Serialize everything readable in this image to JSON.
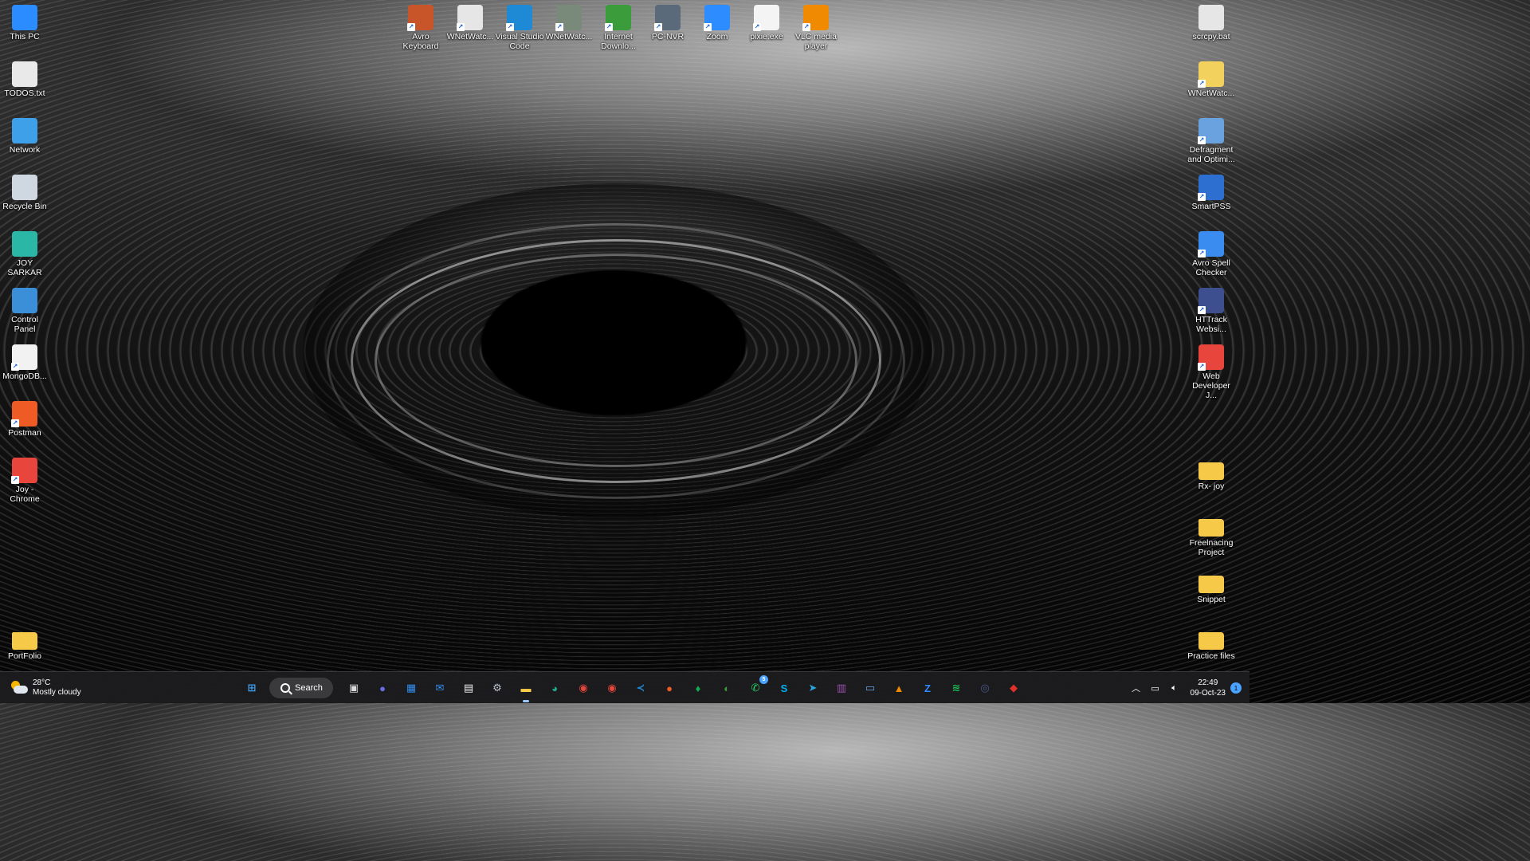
{
  "desktop": {
    "left_column": [
      {
        "name": "this-pc",
        "label": "This PC",
        "icon": "monitor-icon",
        "color": "#2a8cff"
      },
      {
        "name": "todos-txt",
        "label": "TODOS.txt",
        "icon": "text-file-icon",
        "color": "#e9e9e9"
      },
      {
        "name": "network",
        "label": "Network",
        "icon": "network-icon",
        "color": "#3da0e8"
      },
      {
        "name": "recycle-bin",
        "label": "Recycle Bin",
        "icon": "recycle-bin-icon",
        "color": "#cfd8e0"
      },
      {
        "name": "joy-sarkar",
        "label": "JOY SARKAR",
        "icon": "user-folder-icon",
        "color": "#2bb7a6"
      },
      {
        "name": "control-panel",
        "label": "Control Panel",
        "icon": "control-panel-icon",
        "color": "#3a8fd8"
      },
      {
        "name": "mongodb",
        "label": "MongoDB...",
        "icon": "mongodb-icon",
        "color": "#f2f2f2"
      },
      {
        "name": "postman",
        "label": "Postman",
        "icon": "postman-icon",
        "color": "#ef5b25"
      },
      {
        "name": "joy-chrome",
        "label": "Joy - Chrome",
        "icon": "chrome-icon",
        "color": "#e8453c"
      },
      {
        "name": "portfolio",
        "label": "PortFolio",
        "icon": "folder-icon",
        "color": "#f7c948"
      }
    ],
    "top_row": [
      {
        "name": "avro-keyboard",
        "label": "Avro Keyboard",
        "icon": "avro-keyboard-icon",
        "color": "#c8552a"
      },
      {
        "name": "wnetwatcher-1",
        "label": "WNetWatc...",
        "icon": "gear-icon",
        "color": "#e6e6e6"
      },
      {
        "name": "visual-studio-code",
        "label": "Visual Studio Code",
        "icon": "vscode-icon",
        "color": "#1e8ad6"
      },
      {
        "name": "wnetwatcher-2",
        "label": "WNetWatc...",
        "icon": "eye-icon",
        "color": "#7a8a7a"
      },
      {
        "name": "internet-download-manager",
        "label": "Internet Downlo...",
        "icon": "idm-icon",
        "color": "#3b9c3b"
      },
      {
        "name": "pc-nvr",
        "label": "PC-NVR",
        "icon": "pc-nvr-icon",
        "color": "#5a6a7a"
      },
      {
        "name": "zoom",
        "label": "Zoom",
        "icon": "zoom-icon",
        "color": "#2d8cff"
      },
      {
        "name": "pixie-exe",
        "label": "pixie.exe",
        "icon": "color-picker-icon",
        "color": "#f4f4f4"
      },
      {
        "name": "vlc-media-player",
        "label": "VLC media player",
        "icon": "vlc-icon",
        "color": "#f08a00"
      }
    ],
    "right_column": [
      {
        "name": "scrcpy-bat",
        "label": "scrcpy.bat",
        "icon": "gear-file-icon",
        "color": "#e6e6e6"
      },
      {
        "name": "wnetwatcher-3",
        "label": "WNetWatc...",
        "icon": "help-file-icon",
        "color": "#f2d15c"
      },
      {
        "name": "defragment",
        "label": "Defragment and Optimi...",
        "icon": "defrag-icon",
        "color": "#6aa2e0"
      },
      {
        "name": "smartpss",
        "label": "SmartPSS",
        "icon": "camera-icon",
        "color": "#2c6fd1"
      },
      {
        "name": "avro-spell-checker",
        "label": "Avro Spell Checker",
        "icon": "spell-check-icon",
        "color": "#3a8cf0"
      },
      {
        "name": "httrack",
        "label": "HTTrack Websi...",
        "icon": "httrack-icon",
        "color": "#3d4f8f"
      },
      {
        "name": "web-developer-chrome",
        "label": "Web Developer J...",
        "icon": "chrome-icon",
        "color": "#e8453c"
      },
      {
        "name": "rx-joy",
        "label": "Rx- joy",
        "icon": "folder-icon",
        "color": "#f7c948"
      },
      {
        "name": "freelnacing-project",
        "label": "Freelnacing Project",
        "icon": "folder-icon",
        "color": "#f7c948"
      },
      {
        "name": "snippet",
        "label": "Snippet",
        "icon": "folder-icon",
        "color": "#f7c948"
      },
      {
        "name": "practice-files",
        "label": "Practice files",
        "icon": "folder-icon",
        "color": "#f7c948"
      }
    ]
  },
  "taskbar": {
    "weather": {
      "temp": "28°C",
      "condition": "Mostly cloudy"
    },
    "search_label": "Search",
    "apps": [
      {
        "name": "start",
        "icon": "windows-icon",
        "color": "#3fa3f5",
        "glyph": "⊞"
      },
      {
        "name": "search",
        "icon": "search-icon"
      },
      {
        "name": "task-view",
        "icon": "task-view-icon",
        "color": "#d8d8d8",
        "glyph": "▣"
      },
      {
        "name": "teams-chat",
        "icon": "chat-icon",
        "color": "#6b6be8",
        "glyph": "●"
      },
      {
        "name": "widgets",
        "icon": "widgets-icon",
        "color": "#2f8ef0",
        "glyph": "▦"
      },
      {
        "name": "mail",
        "icon": "mail-icon",
        "color": "#2f8ef0",
        "glyph": "✉"
      },
      {
        "name": "store",
        "icon": "store-icon",
        "color": "#f2f2f2",
        "glyph": "▤"
      },
      {
        "name": "settings",
        "icon": "gear-icon",
        "color": "#b8c4d0",
        "glyph": "⚙"
      },
      {
        "name": "file-explorer",
        "icon": "folder-icon",
        "color": "#f7c948",
        "glyph": "▬",
        "active": true
      },
      {
        "name": "edge",
        "icon": "edge-icon",
        "color": "#1faa8a",
        "glyph": "◕"
      },
      {
        "name": "chrome-1",
        "icon": "chrome-icon",
        "color": "#e8453c",
        "glyph": "◉"
      },
      {
        "name": "chrome-2",
        "icon": "chrome-icon",
        "color": "#e8453c",
        "glyph": "◉"
      },
      {
        "name": "vscode",
        "icon": "vscode-icon",
        "color": "#1e8ad6",
        "glyph": "≺"
      },
      {
        "name": "postman",
        "icon": "postman-icon",
        "color": "#ef5b25",
        "glyph": "●"
      },
      {
        "name": "mongodb",
        "icon": "mongodb-icon",
        "color": "#13aa52",
        "glyph": "♦"
      },
      {
        "name": "idm",
        "icon": "idm-icon",
        "color": "#3b9c3b",
        "glyph": "◐"
      },
      {
        "name": "whatsapp",
        "icon": "whatsapp-icon",
        "color": "#25d366",
        "glyph": "✆",
        "badge": "5"
      },
      {
        "name": "skype",
        "icon": "skype-icon",
        "color": "#00aff0",
        "glyph": "S"
      },
      {
        "name": "telegram",
        "icon": "telegram-icon",
        "color": "#2aa3df",
        "glyph": "➤"
      },
      {
        "name": "winrar",
        "icon": "archive-icon",
        "color": "#9b4fb0",
        "glyph": "▥"
      },
      {
        "name": "remote-desktop",
        "icon": "remote-desktop-icon",
        "color": "#6aa2e0",
        "glyph": "▭"
      },
      {
        "name": "vlc",
        "icon": "vlc-icon",
        "color": "#f08a00",
        "glyph": "▲"
      },
      {
        "name": "zoom",
        "icon": "zoom-icon",
        "color": "#2d8cff",
        "glyph": "Z"
      },
      {
        "name": "spotify",
        "icon": "spotify-icon",
        "color": "#1db954",
        "glyph": "≋"
      },
      {
        "name": "camera-app",
        "icon": "camera-icon",
        "color": "#4a5a8a",
        "glyph": "◎"
      },
      {
        "name": "anydesk",
        "icon": "anydesk-icon",
        "color": "#e0302a",
        "glyph": "◆"
      }
    ],
    "tray": {
      "time": "22:49",
      "date": "09-Oct-23",
      "notification_count": "1"
    }
  }
}
